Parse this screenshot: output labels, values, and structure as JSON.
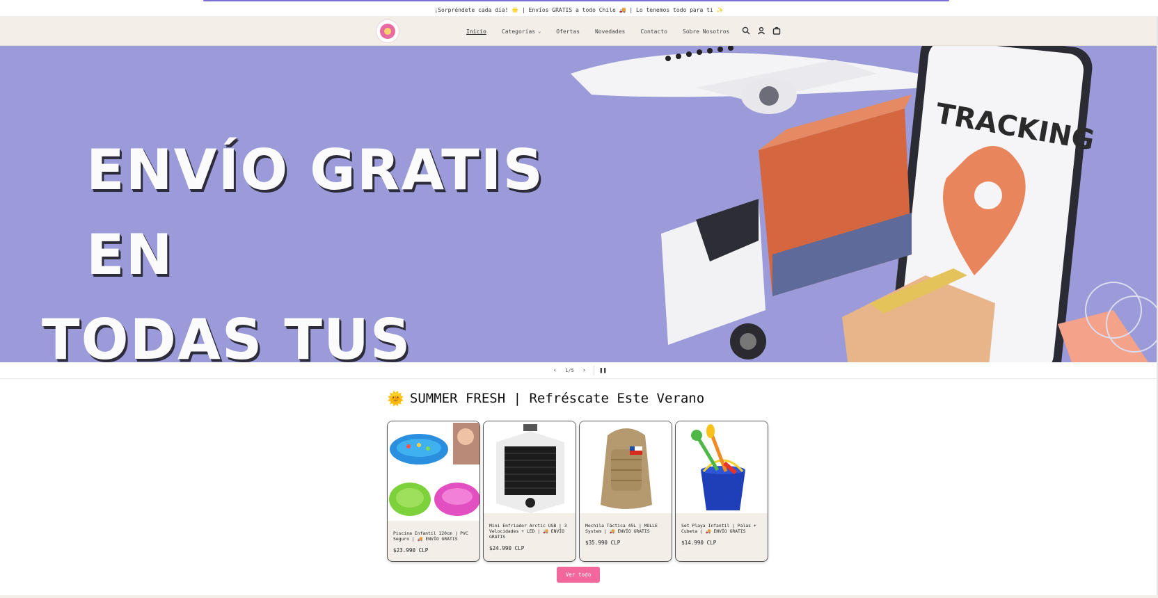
{
  "announcement": {
    "text": "¡Sorpréndete cada día! 🌟 | Envíos GRATIS a todo Chile 🚚 | Lo tenemos todo para ti ✨"
  },
  "header": {
    "nav": [
      {
        "label": "Inicio",
        "active": true
      },
      {
        "label": "Categorías",
        "has_dropdown": true
      },
      {
        "label": "Ofertas"
      },
      {
        "label": "Novedades"
      },
      {
        "label": "Contacto"
      },
      {
        "label": "Sobre Nosotros"
      }
    ],
    "icons": [
      "search-icon",
      "account-icon",
      "cart-icon"
    ]
  },
  "hero": {
    "line1": "ENVÍO GRATIS EN",
    "line2": "TODAS TUS COMPRAS",
    "phone_text": "TRACKING",
    "background": "#9a9bd8"
  },
  "slider": {
    "counter": "1/5",
    "current": 1,
    "total": 5
  },
  "collection": {
    "emoji": "🌞",
    "title": "SUMMER FRESH | Refréscate Este Verano",
    "products": [
      {
        "title": "Piscina Infantil 120cm | PVC Seguro | 🚚 ENVÍO GRATIS",
        "price": "$23.990 CLP"
      },
      {
        "title": "Mini Enfriador Arctic USB | 3 Velocidades + LED | 🚚 ENVÍO GRATIS",
        "price": "$24.990 CLP"
      },
      {
        "title": "Mochila Táctica 45L | MOLLE System | 🚚 ENVÍO GRATIS",
        "price": "$35.990 CLP"
      },
      {
        "title": "Set Playa Infantil | Palas + Cubeta | 🚚 ENVÍO GRATIS",
        "price": "$14.990 CLP"
      }
    ],
    "view_all": "Ver todo"
  },
  "colors": {
    "header_bg": "#f3eee8",
    "accent": "#f2679c",
    "hero_bg": "#9a9bd8"
  }
}
